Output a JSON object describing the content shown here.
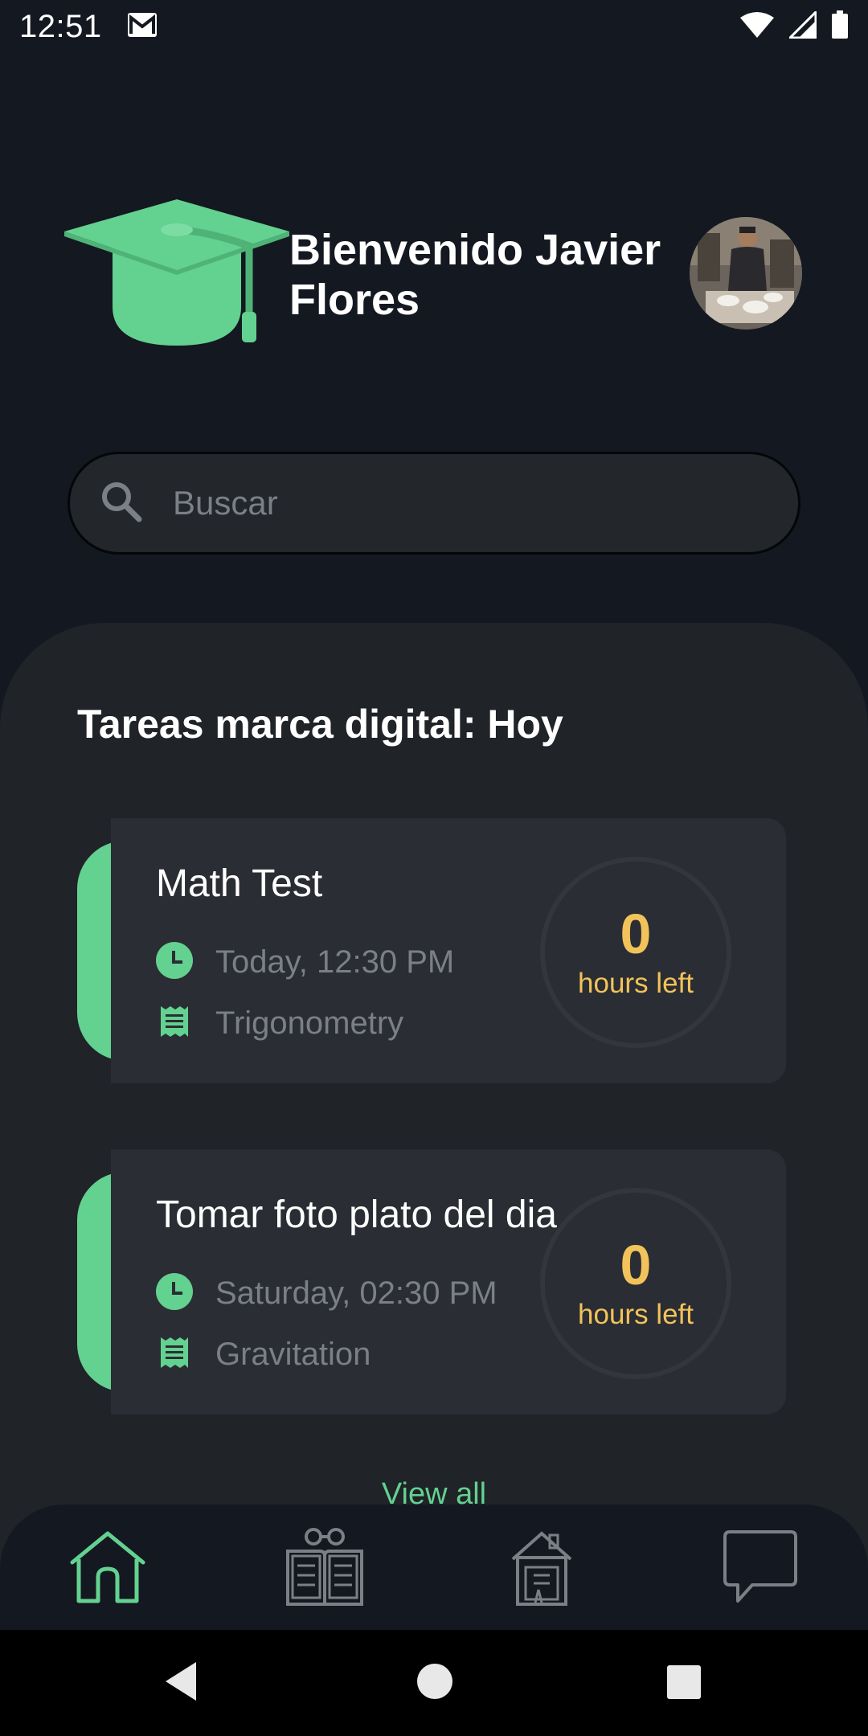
{
  "status_bar": {
    "time": "12:51",
    "icons": [
      "gmail-icon",
      "wifi-icon",
      "signal-icon",
      "battery-icon"
    ]
  },
  "header": {
    "welcome": "Bienvenido Javier Flores",
    "logo_icon": "graduation-cap-icon",
    "avatar": "user-avatar-photo"
  },
  "search": {
    "placeholder": "Buscar",
    "icon": "search-icon"
  },
  "section": {
    "title": "Tareas marca digital: Hoy"
  },
  "tasks": [
    {
      "title": "Math Test",
      "datetime": "Today, 12:30 PM",
      "subject": "Trigonometry",
      "hours": "0",
      "hours_label": "hours left"
    },
    {
      "title": "Tomar foto plato del dia",
      "datetime": "Saturday, 02:30 PM",
      "subject": "Gravitation",
      "hours": "0",
      "hours_label": "hours left"
    }
  ],
  "view_all": "View all",
  "bottom_nav": {
    "items": [
      "home-icon",
      "library-icon",
      "school-icon",
      "chat-icon"
    ],
    "active": "home-icon"
  },
  "system_nav": [
    "back-icon",
    "home-circle-icon",
    "recents-icon"
  ],
  "colors": {
    "accent": "#63d190",
    "highlight": "#f2c35a",
    "background": "#141820",
    "panel": "#202328",
    "card": "#2a2d33"
  }
}
